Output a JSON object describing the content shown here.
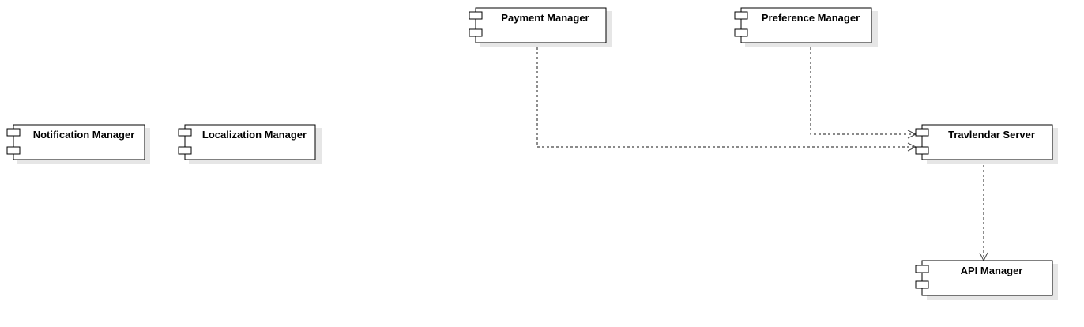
{
  "diagram": {
    "components": [
      {
        "id": "notification-manager",
        "label": "Notification Manager"
      },
      {
        "id": "localization-manager",
        "label": "Localization Manager"
      },
      {
        "id": "payment-manager",
        "label": "Payment Manager"
      },
      {
        "id": "preference-manager",
        "label": "Preference Manager"
      },
      {
        "id": "travlendar-server",
        "label": "Travlendar Server"
      },
      {
        "id": "api-manager",
        "label": "API Manager"
      }
    ],
    "dependencies": [
      {
        "from": "payment-manager",
        "to": "travlendar-server",
        "style": "dashed",
        "arrow": "open"
      },
      {
        "from": "preference-manager",
        "to": "travlendar-server",
        "style": "dashed",
        "arrow": "open"
      },
      {
        "from": "travlendar-server",
        "to": "api-manager",
        "style": "dashed",
        "arrow": "open"
      }
    ]
  }
}
